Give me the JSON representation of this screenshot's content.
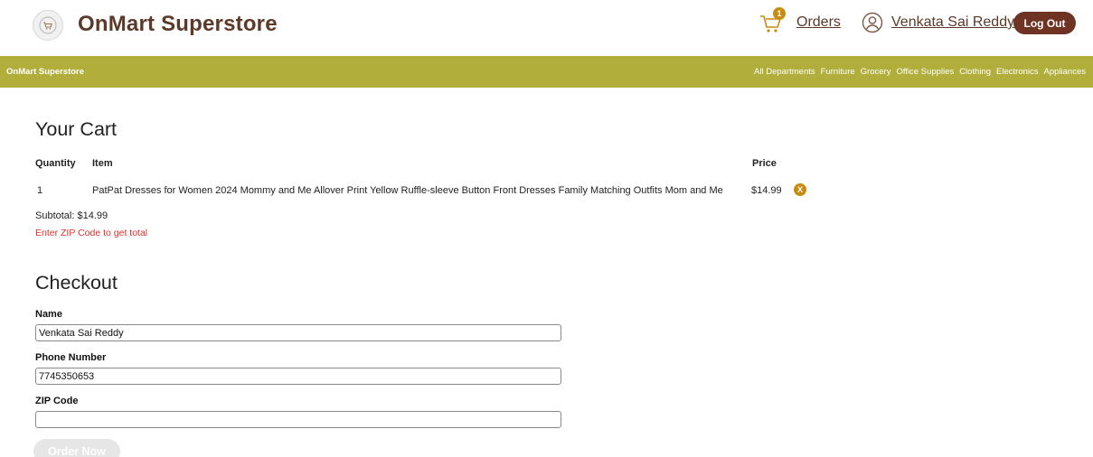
{
  "header": {
    "brand": "OnMart Superstore",
    "cart_count": "1",
    "orders_label": "Orders",
    "user_name": "Venkata Sai Reddy",
    "logout_label": "Log Out",
    "icons": [
      "cart-logo-icon",
      "cart-icon",
      "user-icon"
    ]
  },
  "navbar": {
    "brand": "OnMart Superstore",
    "links": [
      "All Departments",
      "Furniture",
      "Grocery",
      "Office Supplies",
      "Clothing",
      "Electronics",
      "Appliances"
    ]
  },
  "cart": {
    "title": "Your Cart",
    "columns": {
      "quantity": "Quantity",
      "item": "Item",
      "price": "Price"
    },
    "rows": [
      {
        "quantity": "1",
        "item": "PatPat Dresses for Women 2024 Mommy and Me Allover Print Yellow Ruffle-sleeve Button Front Dresses Family Matching Outfits Mom and Me",
        "price": "$14.99",
        "remove_label": "X"
      }
    ],
    "subtotal": "Subtotal: $14.99",
    "zip_message": "Enter ZIP Code to get total"
  },
  "checkout": {
    "title": "Checkout",
    "name_label": "Name",
    "name_value": "Venkata Sai Reddy",
    "phone_label": "Phone Number",
    "phone_value": "7745350653",
    "zip_label": "ZIP Code",
    "zip_value": "",
    "order_label": "Order Now"
  },
  "colors": {
    "brand_brown": "#5b3a29",
    "navbar": "#b1ae3c",
    "logout_bg": "#6e3323",
    "accent_gold": "#c98c10",
    "error_red": "#e0302b",
    "disabled_button": "#e6e6e6"
  }
}
